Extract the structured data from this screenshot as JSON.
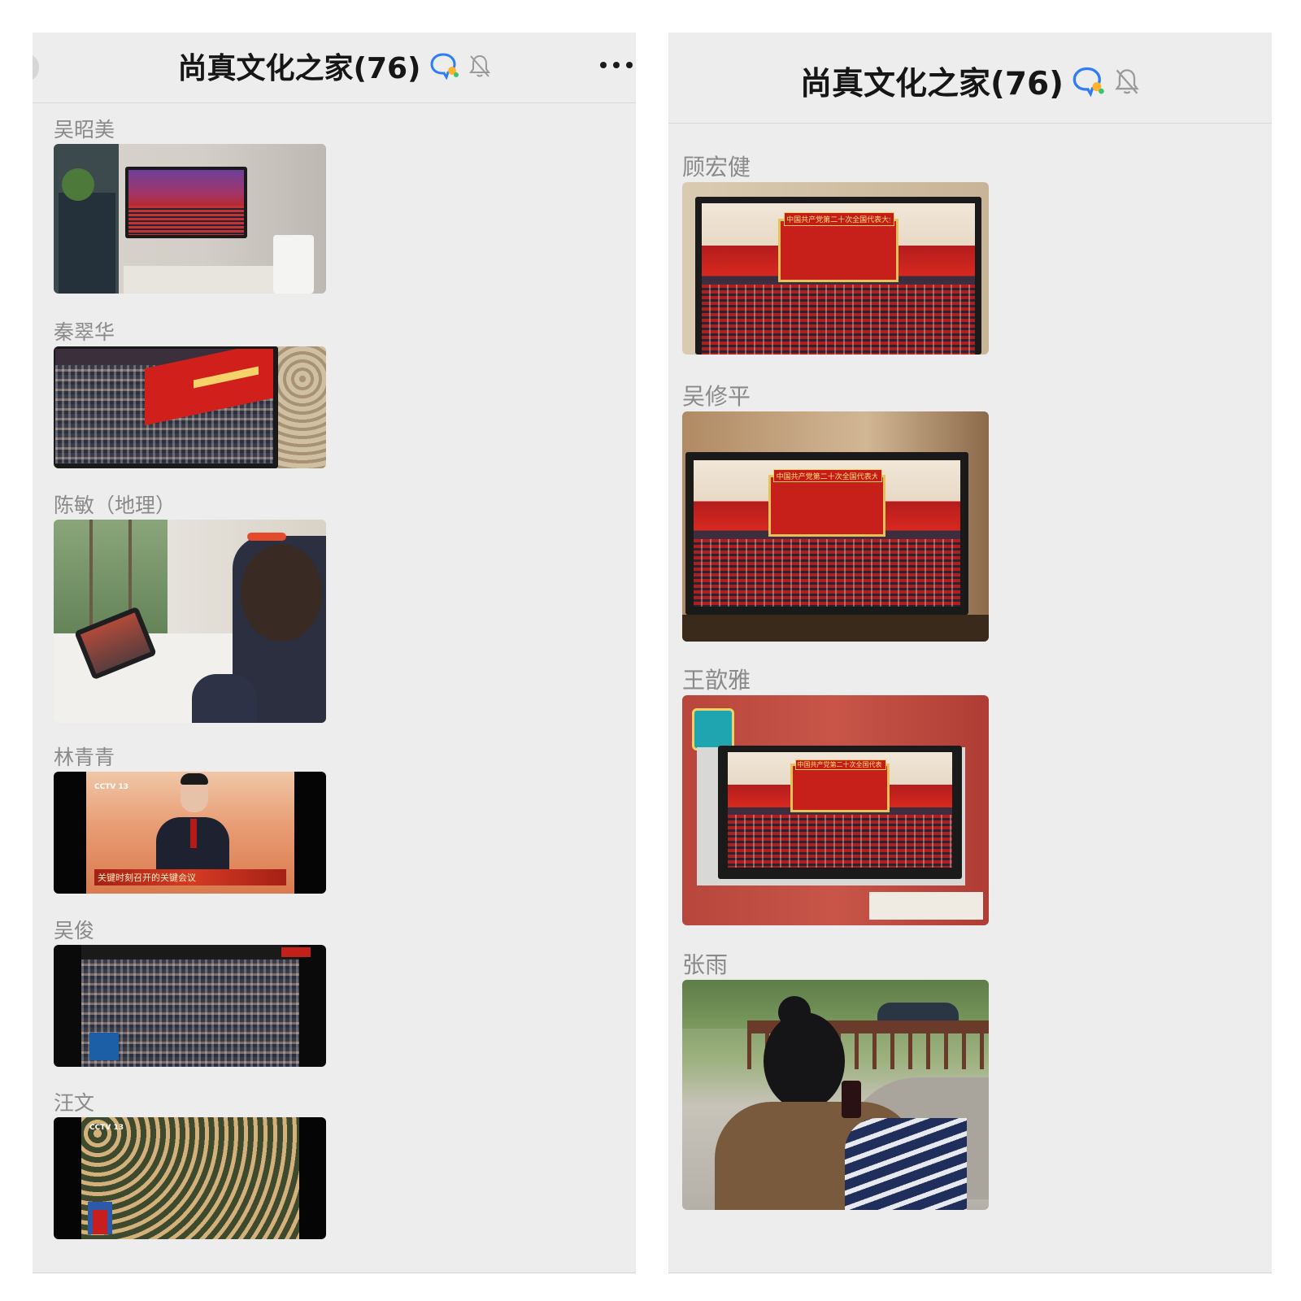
{
  "left_panel": {
    "title": "尚真文化之家(76)",
    "messages": [
      {
        "sender": "吴昭美"
      },
      {
        "sender": "秦翠华"
      },
      {
        "sender": "陈敏（地理）"
      },
      {
        "sender": "林青青",
        "photo_caption": "关键时刻召开的关键会议",
        "photo_logo": "CCTV 13"
      },
      {
        "sender": "吴俊"
      },
      {
        "sender": "汪文",
        "photo_logo": "CCTV 13"
      }
    ]
  },
  "right_panel": {
    "title": "尚真文化之家(76)",
    "messages": [
      {
        "sender": "顾宏健",
        "photo_banner": "中国共产党第二十次全国代表大会"
      },
      {
        "sender": "吴修平",
        "photo_banner": "中国共产党第二十次全国代表大会"
      },
      {
        "sender": "王歆雅",
        "photo_banner": "中国共产党第二十次全国代表大会"
      },
      {
        "sender": "张雨"
      }
    ]
  },
  "icons": {
    "chat_group": "chat-bubble-icon",
    "mute": "bell-off-icon",
    "more": "more-dots-icon",
    "back": "back-icon"
  },
  "colors": {
    "panel_background": "#ededed",
    "title_text": "#161616",
    "sender_text": "#8a8a8a",
    "chat_icon_blue": "#2f7cf6",
    "chat_icon_orange": "#ffb22b"
  }
}
